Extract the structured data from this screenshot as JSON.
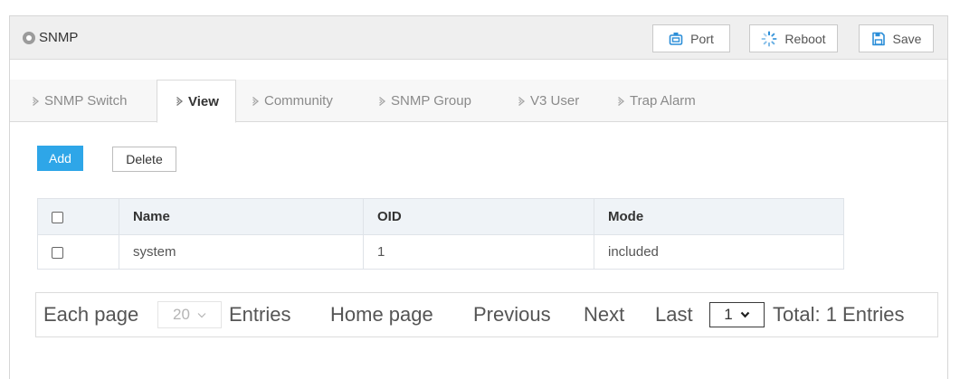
{
  "header": {
    "title": "SNMP",
    "indicator_icon": "circle-dot-icon",
    "buttons": [
      {
        "label": "Port",
        "icon": "port-icon"
      },
      {
        "label": "Reboot",
        "icon": "reboot-icon"
      },
      {
        "label": "Save",
        "icon": "save-icon"
      }
    ]
  },
  "tab_icon": "chevron-right-icon",
  "tabs": [
    {
      "label": "SNMP Switch",
      "active": false
    },
    {
      "label": "View",
      "active": true
    },
    {
      "label": "Community",
      "active": false
    },
    {
      "label": "SNMP Group",
      "active": false
    },
    {
      "label": "V3 User",
      "active": false
    },
    {
      "label": "Trap Alarm",
      "active": false
    }
  ],
  "toolbar": {
    "add_label": "Add",
    "delete_label": "Delete"
  },
  "table": {
    "select_all_checked": false,
    "columns": [
      "Name",
      "OID",
      "Mode"
    ],
    "rows": [
      {
        "checked": false,
        "name": "system",
        "oid": "1",
        "mode": "included"
      }
    ]
  },
  "pagination": {
    "each_page_label": "Each page",
    "page_size": "20",
    "entries_label": "Entries",
    "home_label": "Home page",
    "previous_label": "Previous",
    "next_label": "Next",
    "last_label": "Last",
    "current_page": "1",
    "total_label": "Total: 1 Entries"
  },
  "colors": {
    "accent": "#2ea6e8",
    "icon_blue": "#2b8ed8",
    "header_bg": "#efefef",
    "table_header_bg": "#eff3f7"
  }
}
